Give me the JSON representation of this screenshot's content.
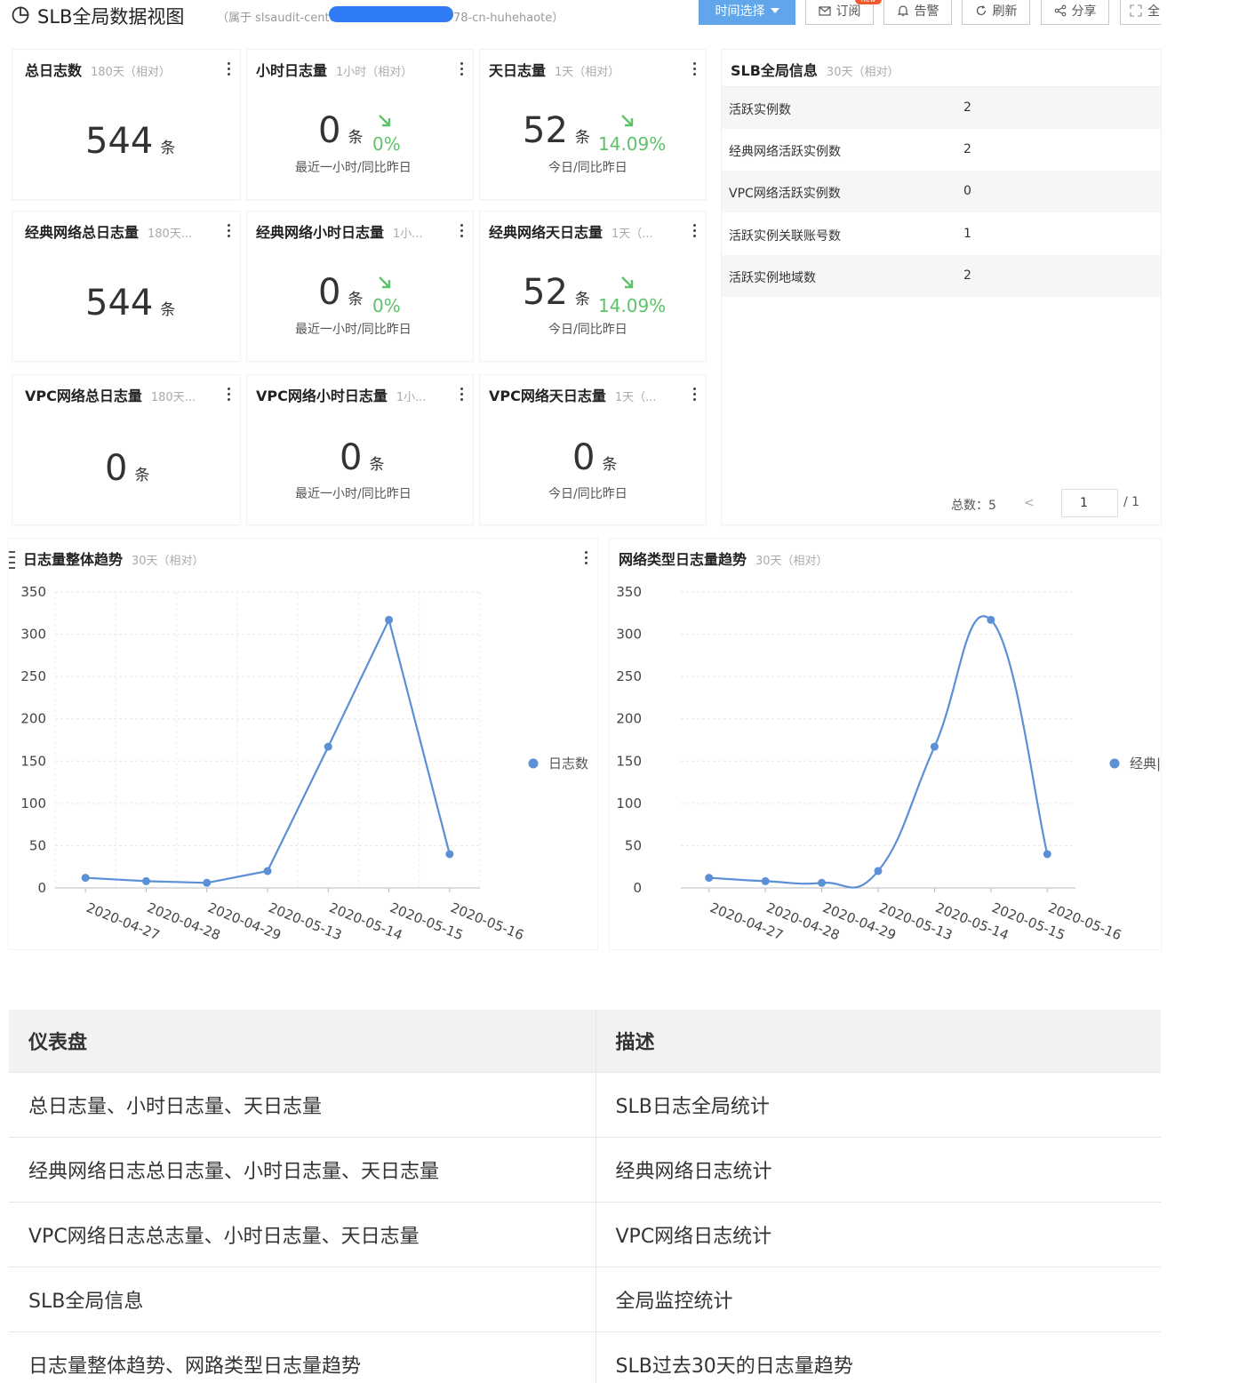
{
  "header": {
    "title": "SLB全局数据视图",
    "belong_prefix": "（属于 slsaudit-cente",
    "belong_suffix": "78-cn-huhehaote）",
    "buttons": {
      "time": "时间选择",
      "subscribe": "订阅",
      "subscribe_badge": "new",
      "alert": "告警",
      "refresh": "刷新",
      "share": "分享",
      "fullscreen": "全"
    }
  },
  "cards": [
    {
      "title": "总日志数",
      "sub": "180天（相对）",
      "value": "544",
      "unit": "条"
    },
    {
      "title": "小时日志量",
      "sub": "1小时（相对）",
      "value": "0",
      "unit": "条",
      "trend": "0%",
      "caption": "最近一小时/同比昨日"
    },
    {
      "title": "天日志量",
      "sub": "1天（相对）",
      "value": "52",
      "unit": "条",
      "trend": "14.09%",
      "caption": "今日/同比昨日"
    },
    {
      "title": "经典网络总日志量",
      "sub": "180天...",
      "value": "544",
      "unit": "条"
    },
    {
      "title": "经典网络小时日志量",
      "sub": "1小...",
      "value": "0",
      "unit": "条",
      "trend": "0%",
      "caption": "最近一小时/同比昨日"
    },
    {
      "title": "经典网络天日志量",
      "sub": "1天（...",
      "value": "52",
      "unit": "条",
      "trend": "14.09%",
      "caption": "今日/同比昨日"
    },
    {
      "title": "VPC网络总日志量",
      "sub": "180天...",
      "value": "0",
      "unit": "条"
    },
    {
      "title": "VPC网络小时日志量",
      "sub": "1小...",
      "value": "0",
      "unit": "条",
      "caption": "最近一小时/同比昨日"
    },
    {
      "title": "VPC网络天日志量",
      "sub": "1天（...",
      "value": "0",
      "unit": "条",
      "caption": "今日/同比昨日"
    }
  ],
  "slb_info": {
    "title": "SLB全局信息",
    "sub": "30天（相对）",
    "rows": [
      {
        "k": "活跃实例数",
        "v": "2"
      },
      {
        "k": "经典网络活跃实例数",
        "v": "2"
      },
      {
        "k": "VPC网络活跃实例数",
        "v": "0"
      },
      {
        "k": "活跃实例关联账号数",
        "v": "1"
      },
      {
        "k": "活跃实例地域数",
        "v": "2"
      }
    ],
    "pager": {
      "total_label": "总数：",
      "total": "5",
      "prev": "<",
      "page": "1",
      "pages": "/ 1"
    }
  },
  "colors": {
    "accent": "#61a6ea",
    "line": "#5b8fd6",
    "up_green": "#5ec26a"
  },
  "chart_data": [
    {
      "type": "line",
      "title": "日志量整体趋势",
      "sub": "30天（相对）",
      "x": [
        "2020-04-27",
        "2020-04-28",
        "2020-04-29",
        "2020-05-13",
        "2020-05-14",
        "2020-05-15",
        "2020-05-16"
      ],
      "series": [
        {
          "name": "日志数",
          "values": [
            12,
            8,
            6,
            20,
            167,
            317,
            40
          ]
        }
      ],
      "yticks": [
        0,
        50,
        100,
        150,
        200,
        250,
        300,
        350
      ],
      "ylim": [
        0,
        350
      ],
      "smooth": false,
      "grid": true,
      "legend": "right"
    },
    {
      "type": "line",
      "title": "网络类型日志量趋势",
      "sub": "30天（相对）",
      "x": [
        "2020-04-27",
        "2020-04-28",
        "2020-04-29",
        "2020-05-13",
        "2020-05-14",
        "2020-05-15",
        "2020-05-16"
      ],
      "series": [
        {
          "name": "经典|",
          "values": [
            12,
            8,
            6,
            20,
            167,
            317,
            40
          ]
        }
      ],
      "yticks": [
        0,
        50,
        100,
        150,
        200,
        250,
        300,
        350
      ],
      "ylim": [
        0,
        350
      ],
      "smooth": true,
      "grid": true,
      "legend": "right"
    }
  ],
  "doc_table": {
    "headers": [
      "仪表盘",
      "描述"
    ],
    "rows": [
      [
        "总日志量、小时日志量、天日志量",
        "SLB日志全局统计"
      ],
      [
        "经典网络日志总日志量、小时日志量、天日志量",
        "经典网络日志统计"
      ],
      [
        "VPC网络日志总志量、小时日志量、天日志量",
        "VPC网络日志统计"
      ],
      [
        "SLB全局信息",
        "全局监控统计"
      ],
      [
        "日志量整体趋势、网路类型日志量趋势",
        "SLB过去30天的日志量趋势"
      ]
    ]
  }
}
